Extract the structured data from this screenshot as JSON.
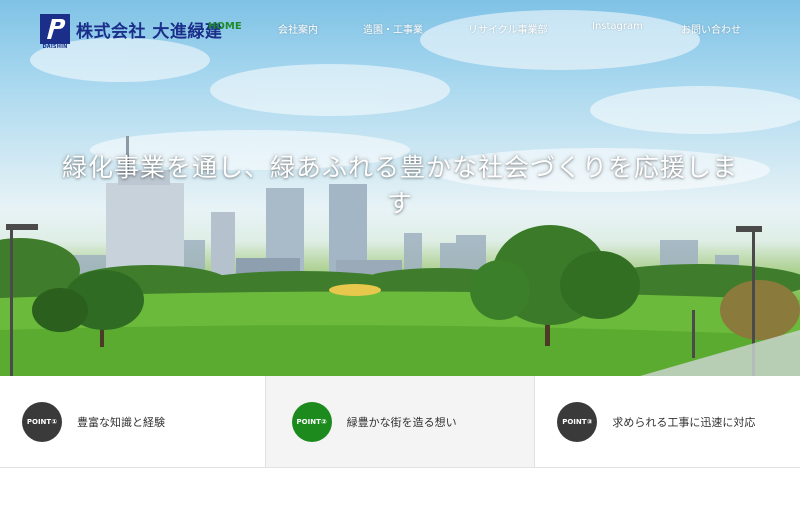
{
  "header": {
    "logo_text": "株式会社 大進緑建",
    "logo_mark_label": "DAISHIN",
    "home_label": "HOME",
    "nav": [
      {
        "label": "会社案内"
      },
      {
        "label": "造園・工事業"
      },
      {
        "label": "リサイクル事業部"
      },
      {
        "label": "Instagram"
      },
      {
        "label": "お問い合わせ"
      }
    ]
  },
  "hero": {
    "catch_line1": "緑化事業を通し、緑あふれる豊かな社会づくりを応援しま",
    "catch_line2": "す"
  },
  "points": [
    {
      "badge": "POINT①",
      "text": "豊富な知識と経験",
      "badge_color": "#3a3a3a"
    },
    {
      "badge": "POINT②",
      "text": "緑豊かな街を造る想い",
      "badge_color": "#1c8a1c"
    },
    {
      "badge": "POINT③",
      "text": "求められる工事に迅速に対応",
      "badge_color": "#3a3a3a"
    }
  ],
  "colors": {
    "brand_blue": "#1b2f8a",
    "accent_green": "#1f8a2a"
  }
}
